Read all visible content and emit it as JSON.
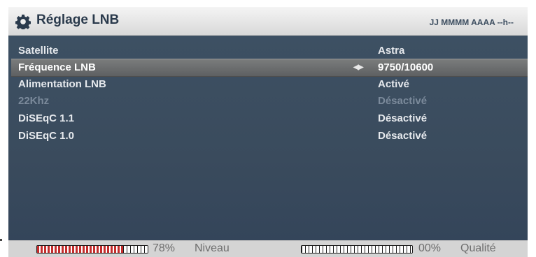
{
  "header": {
    "title": "Réglage LNB",
    "datetime": "JJ MMMM AAAA --h--",
    "icon": "gear-icon"
  },
  "settings": [
    {
      "label": "Satellite",
      "value": "Astra",
      "state": "normal"
    },
    {
      "label": "Fréquence LNB",
      "value": "9750/10600",
      "state": "selected",
      "arrows": "◀▶"
    },
    {
      "label": "Alimentation LNB",
      "value": "Activé",
      "state": "normal"
    },
    {
      "label": "22Khz",
      "value": "Désactivé",
      "state": "disabled"
    },
    {
      "label": "DiSEqC 1.1",
      "value": "Désactivé",
      "state": "normal"
    },
    {
      "label": "DiSEqC 1.0",
      "value": "Désactivé",
      "state": "normal"
    }
  ],
  "footer": {
    "level": {
      "percent_text": "78%",
      "label": "Niveau",
      "fraction": 0.78
    },
    "quality": {
      "percent_text": "00%",
      "label": "Qualité",
      "fraction": 0.0
    }
  },
  "colors": {
    "panel": "#3d5063",
    "selected_row": "#6f7171",
    "meter_fill": "#c42c2c",
    "disabled_text": "#7b8a9b"
  }
}
